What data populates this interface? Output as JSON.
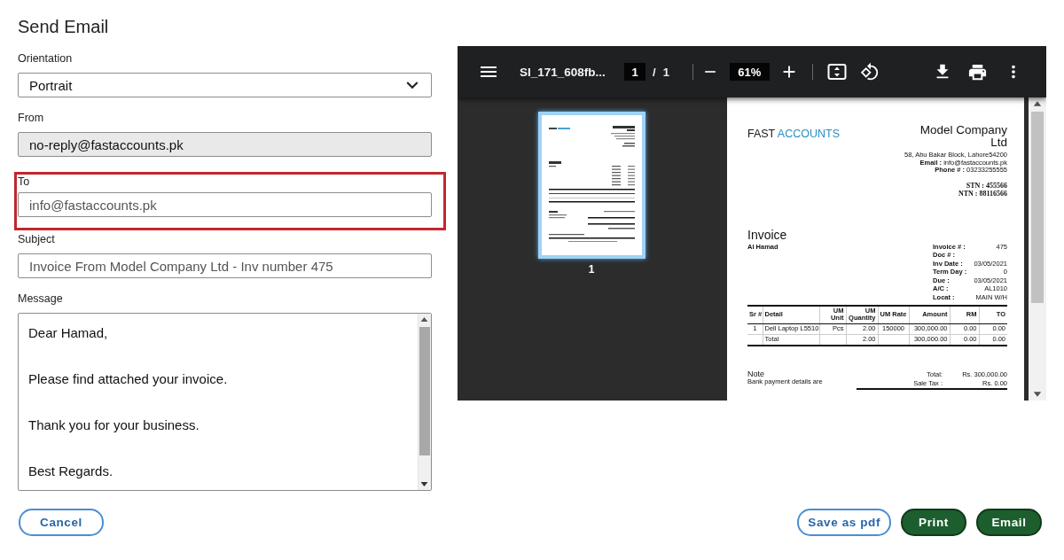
{
  "dialog": {
    "title": "Send Email"
  },
  "fields": [
    {
      "kind": "select",
      "label": "Orientation",
      "value": "Portrait",
      "highlighted": false
    },
    {
      "kind": "readonly",
      "label": "From",
      "value": "no-reply@fastaccounts.pk",
      "highlighted": false
    },
    {
      "kind": "input",
      "label": "To",
      "value": "info@fastaccounts.pk",
      "highlighted": true
    },
    {
      "kind": "input",
      "label": "Subject",
      "value": "Invoice From Model Company Ltd - Inv number 475",
      "highlighted": false
    },
    {
      "kind": "textarea",
      "label": "Message",
      "value": "Dear Hamad,\n\nPlease find attached your invoice.\n\nThank you for your business.\n\nBest Regards.",
      "highlighted": false
    }
  ],
  "pdf_viewer": {
    "toolbar": {
      "file_name": "SI_171_608fb...",
      "page_field": "1",
      "page_divider": "/",
      "page_count": "1",
      "zoom_field": "61%"
    },
    "thumbnails": [
      {
        "label": "1",
        "selected": true
      }
    ],
    "document": {
      "brand": {
        "first": "FAST",
        "second": "ACCOUNTS"
      },
      "company": "Model Company Ltd",
      "address": "58, Abu Bakar Block, Lahore54200",
      "contacts": [
        "**Email :** info@fastaccounts.pk",
        "**Phone # :** 03233255555"
      ],
      "tax_ids": [
        "STN : 455566",
        "NTN : 88116566"
      ],
      "title": "Invoice",
      "customer": "Al Hamad",
      "meta": [
        {
          "label": "Invoice # :",
          "value": "475"
        },
        {
          "label": "Doc # :"
        },
        {
          "label": "Inv Date :",
          "value": "03/05/2021"
        },
        {
          "label": "Term Day :",
          "value": "0"
        },
        {
          "label": "Due :",
          "value": "03/05/2021"
        },
        {
          "label": "A/C :",
          "value": "AL1010"
        },
        {
          "label": "Locat :",
          "value": "MAIN W/H"
        }
      ],
      "table": {
        "columns": [
          "Sr #",
          "Detail",
          "UM Unit",
          "UM Quantity",
          "UM Rate",
          "Amount",
          "RM",
          "TO"
        ],
        "rows": [
          [
            "1",
            "Dell Laptop L5510",
            "Pcs",
            "2.00",
            "150000",
            "300,000.00",
            "0.00",
            "0.00"
          ],
          [
            null,
            "Total",
            null,
            "2.00",
            null,
            "300,000.00",
            "0.00",
            "0.00"
          ]
        ]
      },
      "note": {
        "title": "Note",
        "text": "Bank payment details are"
      },
      "totals": [
        {
          "label": "Total:",
          "value": "Rs. 300,000.00"
        },
        {
          "label": "Sale Tax :",
          "value": "Rs. 0.00"
        }
      ]
    }
  },
  "footer": {
    "left": [
      {
        "label": "Cancel",
        "kind": "outline"
      }
    ],
    "right": [
      {
        "label": "Save as pdf",
        "kind": "outline"
      },
      {
        "label": "Print",
        "kind": "primary"
      },
      {
        "label": "Email",
        "kind": "primary"
      }
    ]
  }
}
